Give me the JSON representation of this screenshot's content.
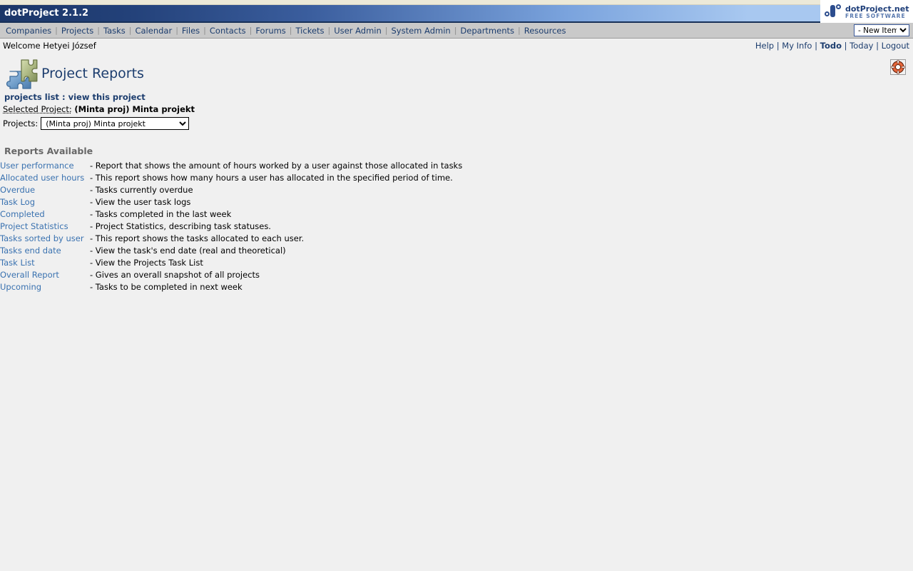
{
  "titlebar": {
    "app_title": "dotProject 2.1.2",
    "brand_name": "dotProject.net",
    "brand_sub": "FREE SOFTWARE",
    "gradient_start": "#1b3668",
    "gradient_end": "#a8c8f0"
  },
  "nav": {
    "items": [
      {
        "label": "Companies"
      },
      {
        "label": "Projects"
      },
      {
        "label": "Tasks"
      },
      {
        "label": "Calendar"
      },
      {
        "label": "Files"
      },
      {
        "label": "Contacts"
      },
      {
        "label": "Forums"
      },
      {
        "label": "Tickets"
      },
      {
        "label": "User Admin"
      },
      {
        "label": "System Admin"
      },
      {
        "label": "Departments"
      },
      {
        "label": "Resources"
      }
    ],
    "new_item_select": {
      "selected": "- New Item -",
      "options": [
        "- New Item -"
      ]
    },
    "link_color": "#1c3d6e",
    "background": "#c9c9c9"
  },
  "welcome": {
    "text": "Welcome Hetyei József",
    "links": [
      {
        "label": "Help",
        "bold": false
      },
      {
        "label": "My Info",
        "bold": false
      },
      {
        "label": "Todo",
        "bold": true
      },
      {
        "label": "Today",
        "bold": false
      },
      {
        "label": "Logout",
        "bold": false
      }
    ],
    "separator": "|"
  },
  "header": {
    "title": "Project Reports",
    "icon": "puzzle-piece-icon",
    "help_icon": "life-ring-help-icon"
  },
  "breadcrumb": {
    "first": "projects list",
    "separator": ":",
    "second": "view this project"
  },
  "project": {
    "selected_label": "Selected Project:",
    "selected_value": "(Minta proj) Minta projekt",
    "select_label": "Projects:",
    "select_value": "(Minta proj) Minta projekt",
    "select_options": [
      "(Minta proj) Minta projekt"
    ]
  },
  "reports": {
    "heading": "Reports Available",
    "link_color": "#3a72b0",
    "items": [
      {
        "name": "User performance",
        "desc": "- Report that shows the amount of hours worked by a user against those allocated in tasks"
      },
      {
        "name": "Allocated user hours",
        "desc": "- This report shows how many hours a user has allocated in the specified period of time."
      },
      {
        "name": "Overdue",
        "desc": "- Tasks currently overdue"
      },
      {
        "name": "Task Log",
        "desc": "- View the user task logs"
      },
      {
        "name": "Completed",
        "desc": "- Tasks completed in the last week"
      },
      {
        "name": "Project Statistics",
        "desc": "- Project Statistics, describing task statuses."
      },
      {
        "name": "Tasks sorted by user",
        "desc": "- This report shows the tasks allocated to each user."
      },
      {
        "name": "Tasks end date",
        "desc": "- View the task's end date (real and theoretical)"
      },
      {
        "name": "Task List",
        "desc": "- View the Projects Task List"
      },
      {
        "name": "Overall Report",
        "desc": "- Gives an overall snapshot of all projects"
      },
      {
        "name": "Upcoming",
        "desc": "- Tasks to be completed in next week"
      }
    ]
  }
}
